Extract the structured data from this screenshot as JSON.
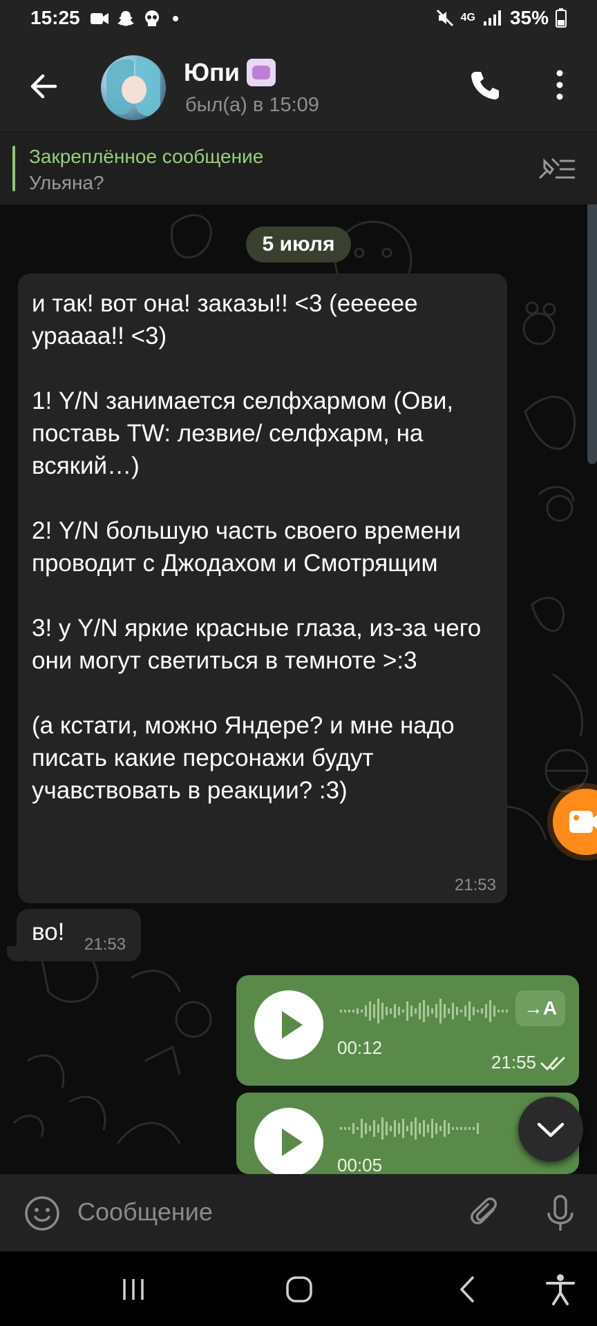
{
  "status_bar": {
    "time": "15:25",
    "network": "4G",
    "battery": "35%"
  },
  "header": {
    "title": "Юпи",
    "status": "был(а) в 15:09"
  },
  "pinned": {
    "title": "Закреплённое сообщение",
    "text": "Ульяна?"
  },
  "date_separator": "5 июля",
  "messages": [
    {
      "type": "incoming",
      "text": "и так! вот она! заказы!! <3 (ееееее урaaaa!! <3)\n\n1! Y/N занимается селфхармом (Ови, поставь TW: лезвие/ селфхарм, на всякий…)\n\n2! Y/N большую часть своего времени проводит с Джодахом и Смотрящим\n\n3! у Y/N яркие красные глаза, из-за чего они могут светиться в темноте >:3\n\n(а кстати, можно Яндере? и мне надо писать какие персонажи будут учавствовать в реакции? :3)",
      "time": "21:53"
    },
    {
      "type": "incoming",
      "text": "во!",
      "time": "21:53"
    },
    {
      "type": "voice_outgoing",
      "duration": "00:12",
      "time": "21:55",
      "transcribe_label": "→A"
    },
    {
      "type": "voice_outgoing",
      "duration": "00:05"
    }
  ],
  "composer": {
    "placeholder": "Сообщение"
  },
  "colors": {
    "accent_green": "#98cf7a",
    "outgoing_bubble": "#5a8a4a",
    "video_fab": "#ff8c1a"
  }
}
